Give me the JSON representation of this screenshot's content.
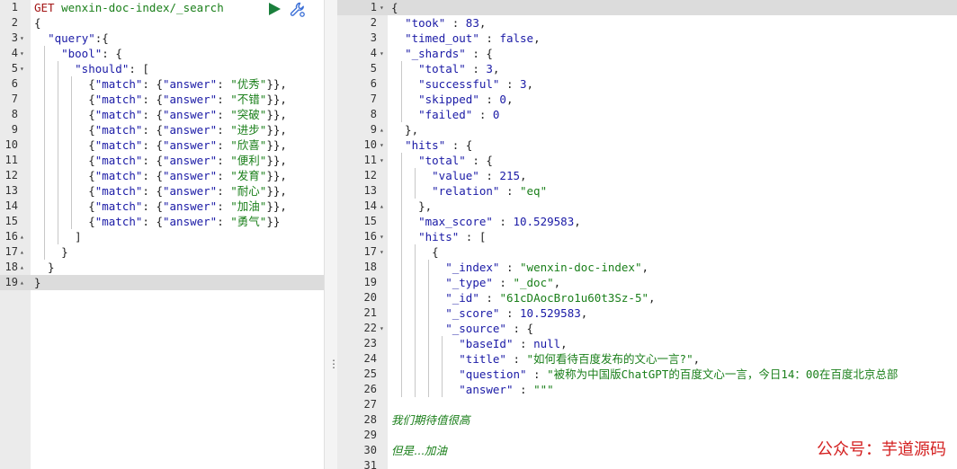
{
  "request": {
    "method": "GET",
    "path": " wenxin-doc-index/_search",
    "lines": [
      {
        "n": "1",
        "fold": "",
        "depth": 0,
        "tokens": [
          {
            "t": "m",
            "v": "GET"
          },
          {
            "t": "s",
            "v": " wenxin-doc-index/_search"
          }
        ]
      },
      {
        "n": "2",
        "fold": "",
        "depth": 0,
        "tokens": [
          {
            "t": "p",
            "v": "{"
          }
        ]
      },
      {
        "n": "3",
        "fold": "▾",
        "depth": 0,
        "tokens": [
          {
            "t": "p",
            "v": "  "
          },
          {
            "t": "k",
            "v": "\"query\""
          },
          {
            "t": "p",
            "v": ":{"
          }
        ]
      },
      {
        "n": "4",
        "fold": "▾",
        "depth": 1,
        "tokens": [
          {
            "t": "p",
            "v": "    "
          },
          {
            "t": "k",
            "v": "\"bool\""
          },
          {
            "t": "p",
            "v": ": {"
          }
        ]
      },
      {
        "n": "5",
        "fold": "▾",
        "depth": 2,
        "tokens": [
          {
            "t": "p",
            "v": "      "
          },
          {
            "t": "k",
            "v": "\"should\""
          },
          {
            "t": "p",
            "v": ": ["
          }
        ]
      },
      {
        "n": "6",
        "fold": "",
        "depth": 3,
        "tokens": [
          {
            "t": "p",
            "v": "        {"
          },
          {
            "t": "k",
            "v": "\"match\""
          },
          {
            "t": "p",
            "v": ": {"
          },
          {
            "t": "k",
            "v": "\"answer\""
          },
          {
            "t": "p",
            "v": ": "
          },
          {
            "t": "s",
            "v": "\"优秀\""
          },
          {
            "t": "p",
            "v": "}},"
          }
        ]
      },
      {
        "n": "7",
        "fold": "",
        "depth": 3,
        "tokens": [
          {
            "t": "p",
            "v": "        {"
          },
          {
            "t": "k",
            "v": "\"match\""
          },
          {
            "t": "p",
            "v": ": {"
          },
          {
            "t": "k",
            "v": "\"answer\""
          },
          {
            "t": "p",
            "v": ": "
          },
          {
            "t": "s",
            "v": "\"不错\""
          },
          {
            "t": "p",
            "v": "}},"
          }
        ]
      },
      {
        "n": "8",
        "fold": "",
        "depth": 3,
        "tokens": [
          {
            "t": "p",
            "v": "        {"
          },
          {
            "t": "k",
            "v": "\"match\""
          },
          {
            "t": "p",
            "v": ": {"
          },
          {
            "t": "k",
            "v": "\"answer\""
          },
          {
            "t": "p",
            "v": ": "
          },
          {
            "t": "s",
            "v": "\"突破\""
          },
          {
            "t": "p",
            "v": "}},"
          }
        ]
      },
      {
        "n": "9",
        "fold": "",
        "depth": 3,
        "tokens": [
          {
            "t": "p",
            "v": "        {"
          },
          {
            "t": "k",
            "v": "\"match\""
          },
          {
            "t": "p",
            "v": ": {"
          },
          {
            "t": "k",
            "v": "\"answer\""
          },
          {
            "t": "p",
            "v": ": "
          },
          {
            "t": "s",
            "v": "\"进步\""
          },
          {
            "t": "p",
            "v": "}},"
          }
        ]
      },
      {
        "n": "10",
        "fold": "",
        "depth": 3,
        "tokens": [
          {
            "t": "p",
            "v": "        {"
          },
          {
            "t": "k",
            "v": "\"match\""
          },
          {
            "t": "p",
            "v": ": {"
          },
          {
            "t": "k",
            "v": "\"answer\""
          },
          {
            "t": "p",
            "v": ": "
          },
          {
            "t": "s",
            "v": "\"欣喜\""
          },
          {
            "t": "p",
            "v": "}},"
          }
        ]
      },
      {
        "n": "11",
        "fold": "",
        "depth": 3,
        "tokens": [
          {
            "t": "p",
            "v": "        {"
          },
          {
            "t": "k",
            "v": "\"match\""
          },
          {
            "t": "p",
            "v": ": {"
          },
          {
            "t": "k",
            "v": "\"answer\""
          },
          {
            "t": "p",
            "v": ": "
          },
          {
            "t": "s",
            "v": "\"便利\""
          },
          {
            "t": "p",
            "v": "}},"
          }
        ]
      },
      {
        "n": "12",
        "fold": "",
        "depth": 3,
        "tokens": [
          {
            "t": "p",
            "v": "        {"
          },
          {
            "t": "k",
            "v": "\"match\""
          },
          {
            "t": "p",
            "v": ": {"
          },
          {
            "t": "k",
            "v": "\"answer\""
          },
          {
            "t": "p",
            "v": ": "
          },
          {
            "t": "s",
            "v": "\"发育\""
          },
          {
            "t": "p",
            "v": "}},"
          }
        ]
      },
      {
        "n": "13",
        "fold": "",
        "depth": 3,
        "tokens": [
          {
            "t": "p",
            "v": "        {"
          },
          {
            "t": "k",
            "v": "\"match\""
          },
          {
            "t": "p",
            "v": ": {"
          },
          {
            "t": "k",
            "v": "\"answer\""
          },
          {
            "t": "p",
            "v": ": "
          },
          {
            "t": "s",
            "v": "\"耐心\""
          },
          {
            "t": "p",
            "v": "}},"
          }
        ]
      },
      {
        "n": "14",
        "fold": "",
        "depth": 3,
        "tokens": [
          {
            "t": "p",
            "v": "        {"
          },
          {
            "t": "k",
            "v": "\"match\""
          },
          {
            "t": "p",
            "v": ": {"
          },
          {
            "t": "k",
            "v": "\"answer\""
          },
          {
            "t": "p",
            "v": ": "
          },
          {
            "t": "s",
            "v": "\"加油\""
          },
          {
            "t": "p",
            "v": "}},"
          }
        ]
      },
      {
        "n": "15",
        "fold": "",
        "depth": 3,
        "tokens": [
          {
            "t": "p",
            "v": "        {"
          },
          {
            "t": "k",
            "v": "\"match\""
          },
          {
            "t": "p",
            "v": ": {"
          },
          {
            "t": "k",
            "v": "\"answer\""
          },
          {
            "t": "p",
            "v": ": "
          },
          {
            "t": "s",
            "v": "\"勇气\""
          },
          {
            "t": "p",
            "v": "}}"
          }
        ]
      },
      {
        "n": "16",
        "fold": "▴",
        "depth": 2,
        "tokens": [
          {
            "t": "p",
            "v": "      ]"
          }
        ]
      },
      {
        "n": "17",
        "fold": "▴",
        "depth": 1,
        "tokens": [
          {
            "t": "p",
            "v": "    }"
          }
        ]
      },
      {
        "n": "18",
        "fold": "▴",
        "depth": 0,
        "tokens": [
          {
            "t": "p",
            "v": "  }"
          }
        ]
      },
      {
        "n": "19",
        "fold": "▴",
        "depth": 0,
        "active": true,
        "tokens": [
          {
            "t": "p",
            "v": "}"
          }
        ]
      }
    ]
  },
  "response": {
    "lines": [
      {
        "n": "1",
        "fold": "▾",
        "depth": 0,
        "active": true,
        "tokens": [
          {
            "t": "p",
            "v": "{"
          }
        ]
      },
      {
        "n": "2",
        "fold": "",
        "depth": 0,
        "tokens": [
          {
            "t": "p",
            "v": "  "
          },
          {
            "t": "k",
            "v": "\"took\""
          },
          {
            "t": "p",
            "v": " : "
          },
          {
            "t": "n",
            "v": "83"
          },
          {
            "t": "p",
            "v": ","
          }
        ]
      },
      {
        "n": "3",
        "fold": "",
        "depth": 0,
        "tokens": [
          {
            "t": "p",
            "v": "  "
          },
          {
            "t": "k",
            "v": "\"timed_out\""
          },
          {
            "t": "p",
            "v": " : "
          },
          {
            "t": "n",
            "v": "false"
          },
          {
            "t": "p",
            "v": ","
          }
        ]
      },
      {
        "n": "4",
        "fold": "▾",
        "depth": 0,
        "tokens": [
          {
            "t": "p",
            "v": "  "
          },
          {
            "t": "k",
            "v": "\"_shards\""
          },
          {
            "t": "p",
            "v": " : {"
          }
        ]
      },
      {
        "n": "5",
        "fold": "",
        "depth": 1,
        "tokens": [
          {
            "t": "p",
            "v": "    "
          },
          {
            "t": "k",
            "v": "\"total\""
          },
          {
            "t": "p",
            "v": " : "
          },
          {
            "t": "n",
            "v": "3"
          },
          {
            "t": "p",
            "v": ","
          }
        ]
      },
      {
        "n": "6",
        "fold": "",
        "depth": 1,
        "tokens": [
          {
            "t": "p",
            "v": "    "
          },
          {
            "t": "k",
            "v": "\"successful\""
          },
          {
            "t": "p",
            "v": " : "
          },
          {
            "t": "n",
            "v": "3"
          },
          {
            "t": "p",
            "v": ","
          }
        ]
      },
      {
        "n": "7",
        "fold": "",
        "depth": 1,
        "tokens": [
          {
            "t": "p",
            "v": "    "
          },
          {
            "t": "k",
            "v": "\"skipped\""
          },
          {
            "t": "p",
            "v": " : "
          },
          {
            "t": "n",
            "v": "0"
          },
          {
            "t": "p",
            "v": ","
          }
        ]
      },
      {
        "n": "8",
        "fold": "",
        "depth": 1,
        "tokens": [
          {
            "t": "p",
            "v": "    "
          },
          {
            "t": "k",
            "v": "\"failed\""
          },
          {
            "t": "p",
            "v": " : "
          },
          {
            "t": "n",
            "v": "0"
          }
        ]
      },
      {
        "n": "9",
        "fold": "▴",
        "depth": 0,
        "tokens": [
          {
            "t": "p",
            "v": "  },"
          }
        ]
      },
      {
        "n": "10",
        "fold": "▾",
        "depth": 0,
        "tokens": [
          {
            "t": "p",
            "v": "  "
          },
          {
            "t": "k",
            "v": "\"hits\""
          },
          {
            "t": "p",
            "v": " : {"
          }
        ]
      },
      {
        "n": "11",
        "fold": "▾",
        "depth": 1,
        "tokens": [
          {
            "t": "p",
            "v": "    "
          },
          {
            "t": "k",
            "v": "\"total\""
          },
          {
            "t": "p",
            "v": " : {"
          }
        ]
      },
      {
        "n": "12",
        "fold": "",
        "depth": 2,
        "tokens": [
          {
            "t": "p",
            "v": "      "
          },
          {
            "t": "k",
            "v": "\"value\""
          },
          {
            "t": "p",
            "v": " : "
          },
          {
            "t": "n",
            "v": "215"
          },
          {
            "t": "p",
            "v": ","
          }
        ]
      },
      {
        "n": "13",
        "fold": "",
        "depth": 2,
        "tokens": [
          {
            "t": "p",
            "v": "      "
          },
          {
            "t": "k",
            "v": "\"relation\""
          },
          {
            "t": "p",
            "v": " : "
          },
          {
            "t": "s",
            "v": "\"eq\""
          }
        ]
      },
      {
        "n": "14",
        "fold": "▴",
        "depth": 1,
        "tokens": [
          {
            "t": "p",
            "v": "    },"
          }
        ]
      },
      {
        "n": "15",
        "fold": "",
        "depth": 1,
        "tokens": [
          {
            "t": "p",
            "v": "    "
          },
          {
            "t": "k",
            "v": "\"max_score\""
          },
          {
            "t": "p",
            "v": " : "
          },
          {
            "t": "n",
            "v": "10.529583"
          },
          {
            "t": "p",
            "v": ","
          }
        ]
      },
      {
        "n": "16",
        "fold": "▾",
        "depth": 1,
        "tokens": [
          {
            "t": "p",
            "v": "    "
          },
          {
            "t": "k",
            "v": "\"hits\""
          },
          {
            "t": "p",
            "v": " : ["
          }
        ]
      },
      {
        "n": "17",
        "fold": "▾",
        "depth": 2,
        "tokens": [
          {
            "t": "p",
            "v": "      {"
          }
        ]
      },
      {
        "n": "18",
        "fold": "",
        "depth": 3,
        "tokens": [
          {
            "t": "p",
            "v": "        "
          },
          {
            "t": "k",
            "v": "\"_index\""
          },
          {
            "t": "p",
            "v": " : "
          },
          {
            "t": "s",
            "v": "\"wenxin-doc-index\""
          },
          {
            "t": "p",
            "v": ","
          }
        ]
      },
      {
        "n": "19",
        "fold": "",
        "depth": 3,
        "tokens": [
          {
            "t": "p",
            "v": "        "
          },
          {
            "t": "k",
            "v": "\"_type\""
          },
          {
            "t": "p",
            "v": " : "
          },
          {
            "t": "s",
            "v": "\"_doc\""
          },
          {
            "t": "p",
            "v": ","
          }
        ]
      },
      {
        "n": "20",
        "fold": "",
        "depth": 3,
        "tokens": [
          {
            "t": "p",
            "v": "        "
          },
          {
            "t": "k",
            "v": "\"_id\""
          },
          {
            "t": "p",
            "v": " : "
          },
          {
            "t": "s",
            "v": "\"61cDAocBro1u60t3Sz-5\""
          },
          {
            "t": "p",
            "v": ","
          }
        ]
      },
      {
        "n": "21",
        "fold": "",
        "depth": 3,
        "tokens": [
          {
            "t": "p",
            "v": "        "
          },
          {
            "t": "k",
            "v": "\"_score\""
          },
          {
            "t": "p",
            "v": " : "
          },
          {
            "t": "n",
            "v": "10.529583"
          },
          {
            "t": "p",
            "v": ","
          }
        ]
      },
      {
        "n": "22",
        "fold": "▾",
        "depth": 3,
        "tokens": [
          {
            "t": "p",
            "v": "        "
          },
          {
            "t": "k",
            "v": "\"_source\""
          },
          {
            "t": "p",
            "v": " : {"
          }
        ]
      },
      {
        "n": "23",
        "fold": "",
        "depth": 4,
        "tokens": [
          {
            "t": "p",
            "v": "          "
          },
          {
            "t": "k",
            "v": "\"baseId\""
          },
          {
            "t": "p",
            "v": " : "
          },
          {
            "t": "n",
            "v": "null"
          },
          {
            "t": "p",
            "v": ","
          }
        ]
      },
      {
        "n": "24",
        "fold": "",
        "depth": 4,
        "tokens": [
          {
            "t": "p",
            "v": "          "
          },
          {
            "t": "k",
            "v": "\"title\""
          },
          {
            "t": "p",
            "v": " : "
          },
          {
            "t": "s",
            "v": "\"如何看待百度发布的文心一言?\""
          },
          {
            "t": "p",
            "v": ","
          }
        ]
      },
      {
        "n": "25",
        "fold": "",
        "depth": 4,
        "tokens": [
          {
            "t": "p",
            "v": "          "
          },
          {
            "t": "k",
            "v": "\"question\""
          },
          {
            "t": "p",
            "v": " : "
          },
          {
            "t": "s",
            "v": "\"被称为中国版ChatGPT的百度文心一言，今日14：00在百度北京总部"
          }
        ]
      },
      {
        "n": "26",
        "fold": "",
        "depth": 4,
        "tokens": [
          {
            "t": "p",
            "v": "          "
          },
          {
            "t": "k",
            "v": "\"answer\""
          },
          {
            "t": "p",
            "v": " : "
          },
          {
            "t": "s",
            "v": "\"\"\""
          }
        ]
      },
      {
        "n": "27",
        "fold": "",
        "depth": 0,
        "tokens": []
      },
      {
        "n": "28",
        "fold": "",
        "depth": 0,
        "tokens": [
          {
            "t": "c",
            "v": "我们期待值很高"
          }
        ]
      },
      {
        "n": "29",
        "fold": "",
        "depth": 0,
        "tokens": []
      },
      {
        "n": "30",
        "fold": "",
        "depth": 0,
        "tokens": [
          {
            "t": "c",
            "v": "但是...加油"
          }
        ]
      },
      {
        "n": "31",
        "fold": "",
        "depth": 0,
        "tokens": []
      }
    ]
  },
  "toolbar": {
    "run_icon": "play-icon",
    "settings_icon": "wrench-icon",
    "run_color": "#1a7f3c",
    "settings_color": "#3b6fd6"
  },
  "watermark": "公众号：芋道源码"
}
